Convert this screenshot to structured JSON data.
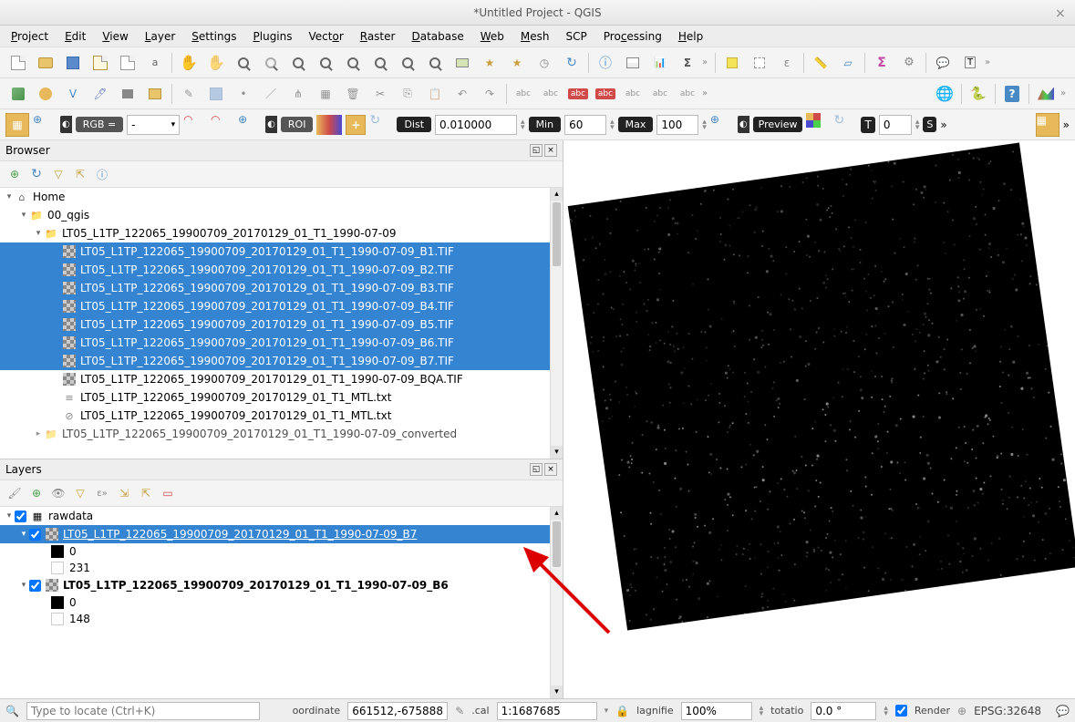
{
  "window": {
    "title": "*Untitled Project - QGIS"
  },
  "menu": [
    "Project",
    "Edit",
    "View",
    "Layer",
    "Settings",
    "Plugins",
    "Vector",
    "Raster",
    "Database",
    "Web",
    "Mesh",
    "SCP",
    "Processing",
    "Help"
  ],
  "scp_toolbar": {
    "rgb_label": "RGB =",
    "rgb_value": "-",
    "roi_label": "ROI",
    "dist_label": "Dist",
    "dist_value": "0.010000",
    "min_label": "Min",
    "min_value": "60",
    "max_label": "Max",
    "max_value": "100",
    "preview_label": "Preview",
    "t_label": "T",
    "t_value": "0",
    "s_label": "S"
  },
  "browser": {
    "title": "Browser",
    "root": "Home",
    "folder1": "00_qgis",
    "folder2": "LT05_L1TP_122065_19900709_20170129_01_T1_1990-07-09",
    "files": [
      "LT05_L1TP_122065_19900709_20170129_01_T1_1990-07-09_B1.TIF",
      "LT05_L1TP_122065_19900709_20170129_01_T1_1990-07-09_B2.TIF",
      "LT05_L1TP_122065_19900709_20170129_01_T1_1990-07-09_B3.TIF",
      "LT05_L1TP_122065_19900709_20170129_01_T1_1990-07-09_B4.TIF",
      "LT05_L1TP_122065_19900709_20170129_01_T1_1990-07-09_B5.TIF",
      "LT05_L1TP_122065_19900709_20170129_01_T1_1990-07-09_B6.TIF",
      "LT05_L1TP_122065_19900709_20170129_01_T1_1990-07-09_B7.TIF",
      "LT05_L1TP_122065_19900709_20170129_01_T1_1990-07-09_BQA.TIF",
      "LT05_L1TP_122065_19900709_20170129_01_T1_MTL.txt",
      "LT05_L1TP_122065_19900709_20170129_01_T1_MTL.txt"
    ],
    "truncated": "LT05_L1TP_122065_19900709_20170129_01_T1_1990-07-09_converted"
  },
  "layers": {
    "title": "Layers",
    "group": "rawdata",
    "items": [
      {
        "name": "LT05_L1TP_122065_19900709_20170129_01_T1_1990-07-09_B7",
        "sel": true,
        "min": "0",
        "max": "231"
      },
      {
        "name": "LT05_L1TP_122065_19900709_20170129_01_T1_1990-07-09_B6",
        "sel": false,
        "min": "0",
        "max": "148"
      }
    ]
  },
  "status": {
    "locate_placeholder": "Type to locate (Ctrl+K)",
    "coord_label": "oordinate",
    "coord_value": "661512,-675888",
    "scale_label": ".cal",
    "scale_value": "1:1687685",
    "mag_label": "lagnifie",
    "mag_value": "100%",
    "rot_label": "totatio",
    "rot_value": "0.0 °",
    "render_label": "Render",
    "crs": "EPSG:32648"
  }
}
